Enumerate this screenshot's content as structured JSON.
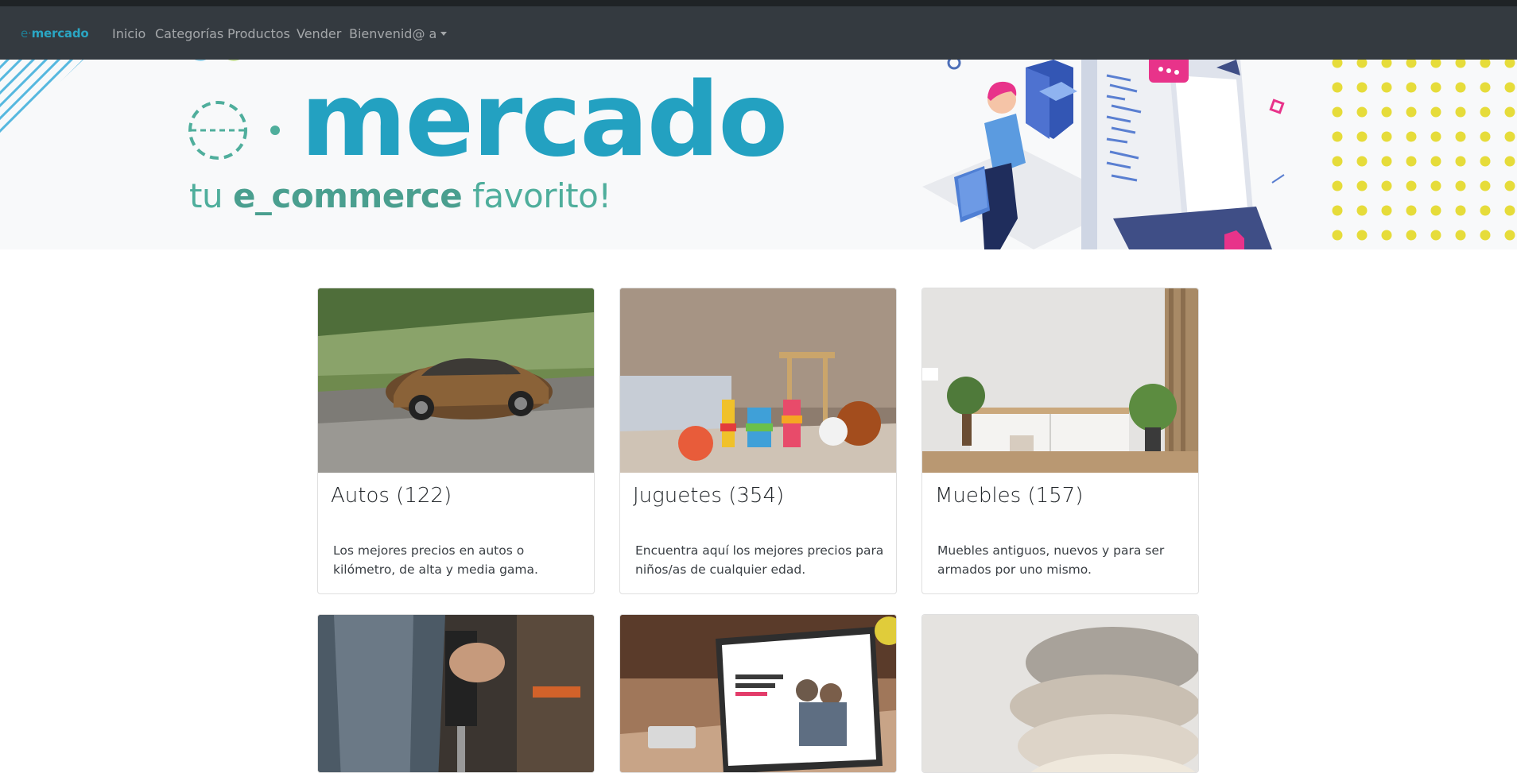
{
  "navbar": {
    "brand_prefix": "e·",
    "brand": "mercado",
    "items": [
      {
        "label": "Inicio"
      },
      {
        "label": "Categorías"
      },
      {
        "label": "Productos"
      },
      {
        "label": "Vender"
      },
      {
        "label": "Bienvenid@ a",
        "dropdown": true
      }
    ]
  },
  "hero": {
    "title": "mercado",
    "subtitle_pre": "tu ",
    "subtitle_bold": "e_commerce",
    "subtitle_post": " favorito!"
  },
  "categories": [
    {
      "title": "Autos (122)",
      "text": "Los mejores precios en autos o kilómetro, de alta y media gama.",
      "image": "car-photo"
    },
    {
      "title": "Juguetes (354)",
      "text": "Encuentra aquí los mejores precios para niños/as de cualquier edad.",
      "image": "toys-photo"
    },
    {
      "title": "Muebles (157)",
      "text": "Muebles antiguos, nuevos y para ser armados por uno mismo.",
      "image": "furniture-photo"
    },
    {
      "image": "tools-photo"
    },
    {
      "image": "computers-photo"
    },
    {
      "image": "clothing-photo"
    }
  ],
  "colors": {
    "navbar": "#343a40",
    "brand": "#23a1c1",
    "subtitle": "#4fae9c",
    "dots": "#e6dc3a"
  }
}
